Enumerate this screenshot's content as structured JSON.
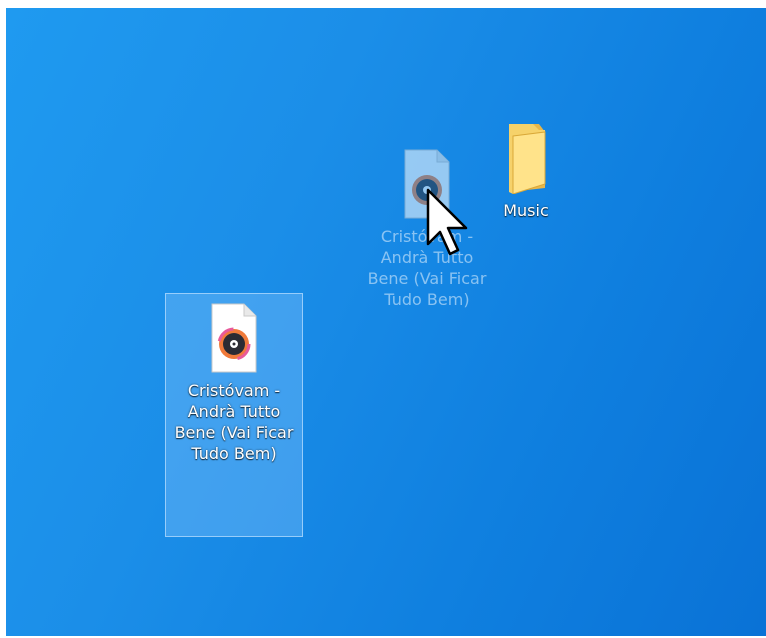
{
  "desktop": {
    "background_color": "#1b8ee8",
    "icons": [
      {
        "label": "Cristóvam - Andrà Tutto Bene (Vai Ficar Tudo Bem)",
        "type": "audio-file",
        "icon": "music-file-icon",
        "state": "selected"
      },
      {
        "label": "Cristóvam - Andrà Tutto Bene (Vai Ficar Tudo Bem)",
        "type": "audio-file",
        "icon": "music-file-icon",
        "state": "drag-preview"
      },
      {
        "label": "Music",
        "type": "folder",
        "icon": "folder-icon",
        "state": "normal"
      }
    ]
  },
  "cursor": {
    "icon": "arrow-cursor-icon"
  }
}
